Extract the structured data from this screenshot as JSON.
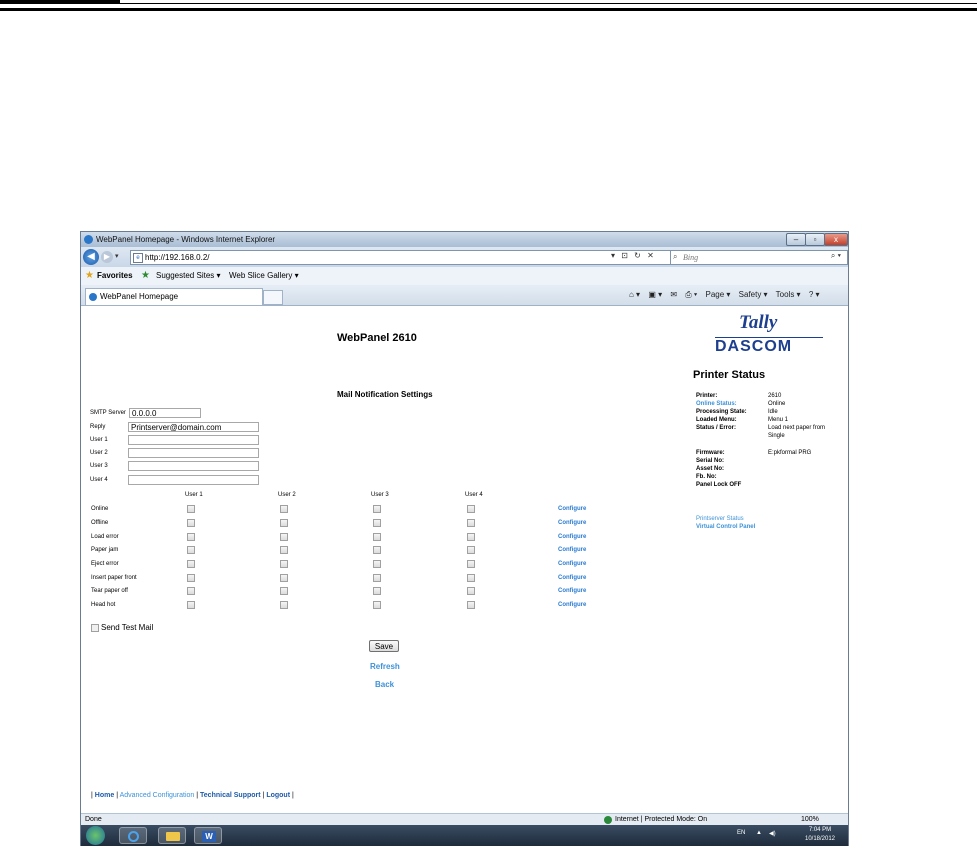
{
  "window": {
    "title": "WebPanel Homepage - Windows Internet Explorer",
    "minimize": "–",
    "maximize": "▫",
    "close": "x"
  },
  "address": {
    "url": "http://192.168.0.2/",
    "search_placeholder": "Bing",
    "tools": "▾ ⊡ ↻ ✕"
  },
  "favorites": {
    "label": "Favorites",
    "items": [
      "Suggested Sites ▾",
      "Web Slice Gallery ▾"
    ]
  },
  "tab": {
    "label": "WebPanel Homepage"
  },
  "commandbar": {
    "items": [
      "Page ▾",
      "Safety ▾",
      "Tools ▾"
    ]
  },
  "page": {
    "title": "WebPanel 2610",
    "logo_top": "Tally",
    "logo_bottom": "DASCOM",
    "section_title": "Mail Notification Settings"
  },
  "form": {
    "smtp_label": "SMTP Server",
    "smtp_value": "0.0.0.0",
    "reply_label": "Reply",
    "reply_value": "Printserver@domain.com",
    "user_labels": [
      "User 1",
      "User 2",
      "User 3",
      "User 4"
    ],
    "user_values": [
      "",
      "",
      "",
      ""
    ],
    "columns": [
      "User 1",
      "User 2",
      "User 3",
      "User 4"
    ],
    "rows": [
      "Online",
      "Offline",
      "Load error",
      "Paper jam",
      "Eject error",
      "Insert paper front",
      "Tear paper off",
      "Head hot"
    ],
    "configure_label": "Configure",
    "send_test_mail": "Send Test Mail",
    "save": "Save",
    "refresh": "Refresh",
    "back": "Back"
  },
  "status": {
    "title": "Printer Status",
    "printer_label": "Printer:",
    "printer_value": "2610",
    "online_label": "Online Status:",
    "online_value": "Online",
    "processing_label": "Processing State:",
    "processing_value": "Idle",
    "loaded_label": "Loaded Menu:",
    "loaded_value": "Menu 1",
    "error_label": "Status / Error:",
    "error_value_line1": "Load next paper from",
    "error_value_line2": "Single",
    "firmware_label": "Firmware:",
    "firmware_value": "E:pkformal PRG",
    "serial_label": "Serial No:",
    "asset_label": "Asset No:",
    "fb_label": "Fb. No:",
    "panel_lock": "Panel Lock OFF",
    "link_printserver": "Printserver Status",
    "link_vcp": "Virtual Control Panel"
  },
  "footer": {
    "sep": "|",
    "home": "Home",
    "advanced": "Advanced Configuration",
    "support": "Technical Support",
    "logout": "Logout"
  },
  "statusbar": {
    "left": "Done",
    "zone": "Internet | Protected Mode: On",
    "zoom": "100%"
  },
  "taskbar": {
    "lang": "EN",
    "arrow": "▲",
    "sound": "◀)",
    "time": "7:04 PM",
    "date": "10/18/2012"
  }
}
